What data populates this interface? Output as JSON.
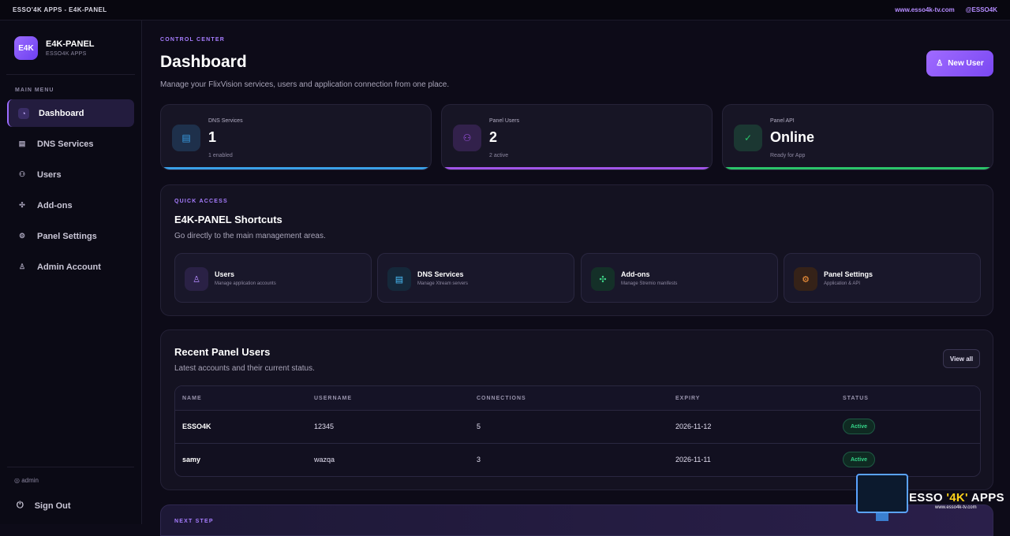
{
  "topbar": {
    "title": "ESSO'4K APPS - E4K-PANEL",
    "website": "www.esso4k-tv.com",
    "handle": "@ESSO4K"
  },
  "brand": {
    "logo": "E4K",
    "name": "E4K-PANEL",
    "subtitle": "ESSO4K APPS"
  },
  "sidebar": {
    "menu_label": "MAIN MENU",
    "items": [
      {
        "label": "Dashboard",
        "icon": "gauge-icon",
        "glyph": "◔",
        "active": true
      },
      {
        "label": "DNS Services",
        "icon": "server-icon",
        "glyph": "▤"
      },
      {
        "label": "Users",
        "icon": "users-icon",
        "glyph": "⚇"
      },
      {
        "label": "Add-ons",
        "icon": "puzzle-icon",
        "glyph": "✣"
      },
      {
        "label": "Panel Settings",
        "icon": "gear-icon",
        "glyph": "⚙"
      },
      {
        "label": "Admin Account",
        "icon": "user-gear-icon",
        "glyph": "♙"
      }
    ],
    "admin": "◎ admin",
    "sign_out": "Sign Out",
    "sign_out_glyph": "⏻"
  },
  "header": {
    "eyebrow": "CONTROL CENTER",
    "title": "Dashboard",
    "subtitle": "Manage your FlixVision services, users and application connection from one place.",
    "new_user": "New User",
    "new_user_glyph": "♙"
  },
  "stats": [
    {
      "label": "DNS Services",
      "value": "1",
      "meta": "1 enabled",
      "icon": "server-icon",
      "glyph": "▤",
      "color": "#3aa0e8"
    },
    {
      "label": "Panel Users",
      "value": "2",
      "meta": "2 active",
      "icon": "users-icon",
      "glyph": "⚇",
      "color": "#a155e8"
    },
    {
      "label": "Panel API",
      "value": "Online",
      "meta": "Ready for App",
      "icon": "check-circle-icon",
      "glyph": "✓",
      "color": "#2bc46a"
    }
  ],
  "quick_access": {
    "eyebrow": "QUICK ACCESS",
    "title": "E4K-PANEL Shortcuts",
    "subtitle": "Go directly to the main management areas.",
    "shortcuts": [
      {
        "title": "Users",
        "desc": "Manage application accounts",
        "icon": "user-add-icon",
        "glyph": "♙",
        "color": "#b58cff",
        "bg": "#2a2145"
      },
      {
        "title": "DNS Services",
        "desc": "Manage Xtream servers",
        "icon": "server-icon",
        "glyph": "▤",
        "color": "#4cc3ff",
        "bg": "#15283a"
      },
      {
        "title": "Add-ons",
        "desc": "Manage Stremio manifests",
        "icon": "puzzle-icon",
        "glyph": "✣",
        "color": "#3fd88a",
        "bg": "#143028"
      },
      {
        "title": "Panel Settings",
        "desc": "Application & API",
        "icon": "gear-icon",
        "glyph": "⚙",
        "color": "#ff9a3d",
        "bg": "#352218"
      }
    ]
  },
  "recent_users": {
    "title": "Recent Panel Users",
    "subtitle": "Latest accounts and their current status.",
    "view_all": "View all",
    "columns": [
      "NAME",
      "USERNAME",
      "CONNECTIONS",
      "EXPIRY",
      "STATUS"
    ],
    "rows": [
      {
        "name": "ESSO4K",
        "username": "12345",
        "connections": "5",
        "expiry": "2026-11-12",
        "status": "Active"
      },
      {
        "name": "samy",
        "username": "wazqa",
        "connections": "3",
        "expiry": "2026-11-11",
        "status": "Active"
      }
    ]
  },
  "next_step": {
    "eyebrow": "NEXT STEP"
  },
  "watermark": {
    "pre": "ESSO ",
    "quoted": "'4K'",
    "post": " APPS",
    "url": "www.esso4k-tv.com"
  }
}
